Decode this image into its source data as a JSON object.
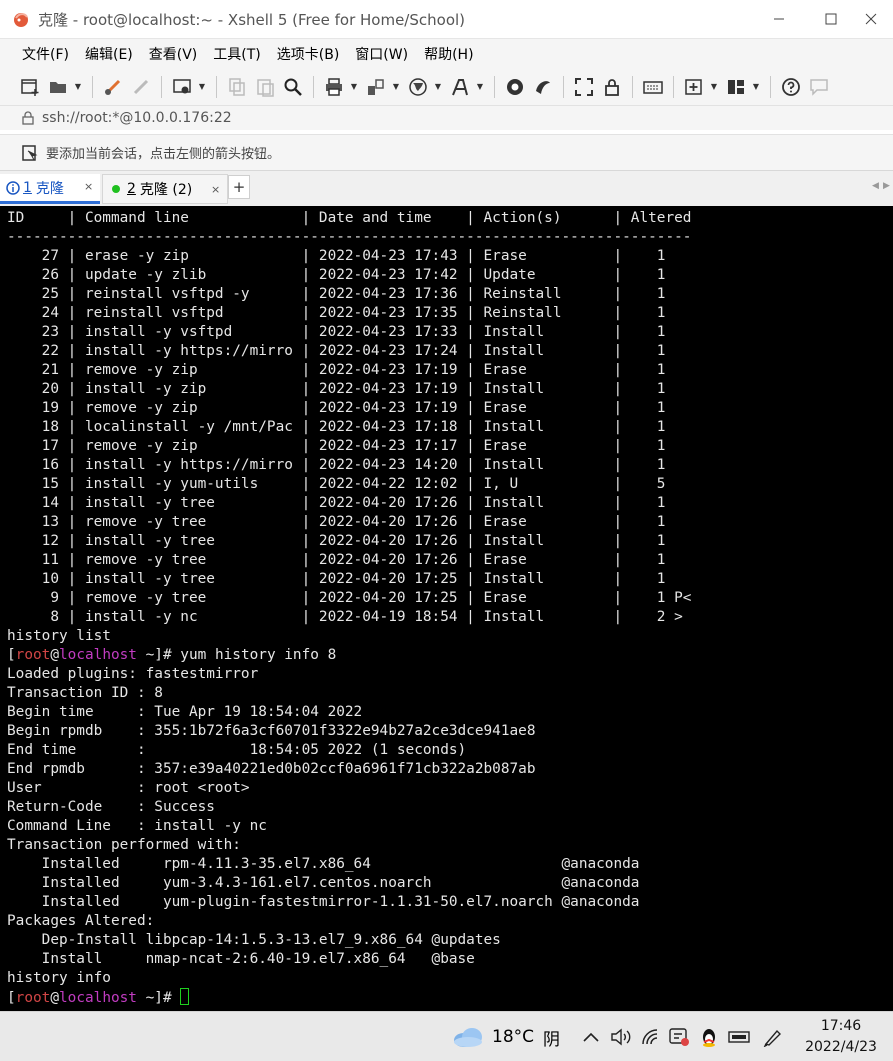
{
  "window": {
    "title": "克隆 - root@localhost:~ - Xshell 5 (Free for Home/School)"
  },
  "menu": [
    "文件(F)",
    "编辑(E)",
    "查看(V)",
    "工具(T)",
    "选项卡(B)",
    "窗口(W)",
    "帮助(H)"
  ],
  "address": {
    "text": "ssh://root:*@10.0.0.176:22"
  },
  "hint": {
    "text": "要添加当前会话，点击左侧的箭头按钮。"
  },
  "tabs": [
    {
      "number": "1",
      "label": "克隆",
      "close": "×"
    },
    {
      "number": "2",
      "label": "克隆 (2)",
      "close": "×"
    }
  ],
  "tab_add": "+",
  "terminal": {
    "lines": [
      {
        "text": "ID     | Command line             | Date and time    | Action(s)      | Altered"
      },
      {
        "text": "-------------------------------------------------------------------------------"
      },
      {
        "text": "    27 | erase -y zip             | 2022-04-23 17:43 | Erase          |    1"
      },
      {
        "text": "    26 | update -y zlib           | 2022-04-23 17:42 | Update         |    1"
      },
      {
        "text": "    25 | reinstall vsftpd -y      | 2022-04-23 17:36 | Reinstall      |    1"
      },
      {
        "text": "    24 | reinstall vsftpd         | 2022-04-23 17:35 | Reinstall      |    1"
      },
      {
        "text": "    23 | install -y vsftpd        | 2022-04-23 17:33 | Install        |    1"
      },
      {
        "text": "    22 | install -y https://mirro | 2022-04-23 17:24 | Install        |    1"
      },
      {
        "text": "    21 | remove -y zip            | 2022-04-23 17:19 | Erase          |    1"
      },
      {
        "text": "    20 | install -y zip           | 2022-04-23 17:19 | Install        |    1"
      },
      {
        "text": "    19 | remove -y zip            | 2022-04-23 17:19 | Erase          |    1"
      },
      {
        "text": "    18 | localinstall -y /mnt/Pac | 2022-04-23 17:18 | Install        |    1"
      },
      {
        "text": "    17 | remove -y zip            | 2022-04-23 17:17 | Erase          |    1"
      },
      {
        "text": "    16 | install -y https://mirro | 2022-04-23 14:20 | Install        |    1"
      },
      {
        "text": "    15 | install -y yum-utils     | 2022-04-22 12:02 | I, U           |    5"
      },
      {
        "text": "    14 | install -y tree          | 2022-04-20 17:26 | Install        |    1"
      },
      {
        "text": "    13 | remove -y tree           | 2022-04-20 17:26 | Erase          |    1"
      },
      {
        "text": "    12 | install -y tree          | 2022-04-20 17:26 | Install        |    1"
      },
      {
        "text": "    11 | remove -y tree           | 2022-04-20 17:26 | Erase          |    1"
      },
      {
        "text": "    10 | install -y tree          | 2022-04-20 17:25 | Install        |    1"
      },
      {
        "text": "     9 | remove -y tree           | 2022-04-20 17:25 | Erase          |    1 P<"
      },
      {
        "text": "     8 | install -y nc            | 2022-04-19 18:54 | Install        |    2 >"
      },
      {
        "text": "history list"
      },
      {
        "prompt": true,
        "user": "root",
        "host": "localhost",
        "cmd": " ~]# yum history info 8"
      },
      {
        "text": "Loaded plugins: fastestmirror"
      },
      {
        "text": "Transaction ID : 8"
      },
      {
        "text": "Begin time     : Tue Apr 19 18:54:04 2022"
      },
      {
        "text": "Begin rpmdb    : 355:1b72f6a3cf60701f3322e94b27a2ce3dce941ae8"
      },
      {
        "text": "End time       :            18:54:05 2022 (1 seconds)"
      },
      {
        "text": "End rpmdb      : 357:e39a40221ed0b02ccf0a6961f71cb322a2b087ab"
      },
      {
        "text": "User           : root <root>"
      },
      {
        "text": "Return-Code    : Success"
      },
      {
        "text": "Command Line   : install -y nc"
      },
      {
        "text": "Transaction performed with:"
      },
      {
        "text": "    Installed     rpm-4.11.3-35.el7.x86_64                      @anaconda"
      },
      {
        "text": "    Installed     yum-3.4.3-161.el7.centos.noarch               @anaconda"
      },
      {
        "text": "    Installed     yum-plugin-fastestmirror-1.1.31-50.el7.noarch @anaconda"
      },
      {
        "text": "Packages Altered:"
      },
      {
        "text": "    Dep-Install libpcap-14:1.5.3-13.el7_9.x86_64 @updates"
      },
      {
        "text": "    Install     nmap-ncat-2:6.40-19.el7.x86_64   @base"
      },
      {
        "text": "history info"
      },
      {
        "prompt": true,
        "user": "root",
        "host": "localhost",
        "cmd": " ~]# ",
        "cursor": true
      }
    ]
  },
  "taskbar": {
    "temperature": "18°C",
    "condition": "阴",
    "time": "17:46",
    "date": "2022/4/23"
  },
  "colors": {
    "terminal_bg": "#000000",
    "terminal_fg": "#e6e6e6",
    "prompt_user": "#d04545",
    "prompt_host": "#c13cc1",
    "cursor": "#1fd01f",
    "active_tab_accent": "#2f6fd6",
    "session_dot": "#1fc01f"
  }
}
